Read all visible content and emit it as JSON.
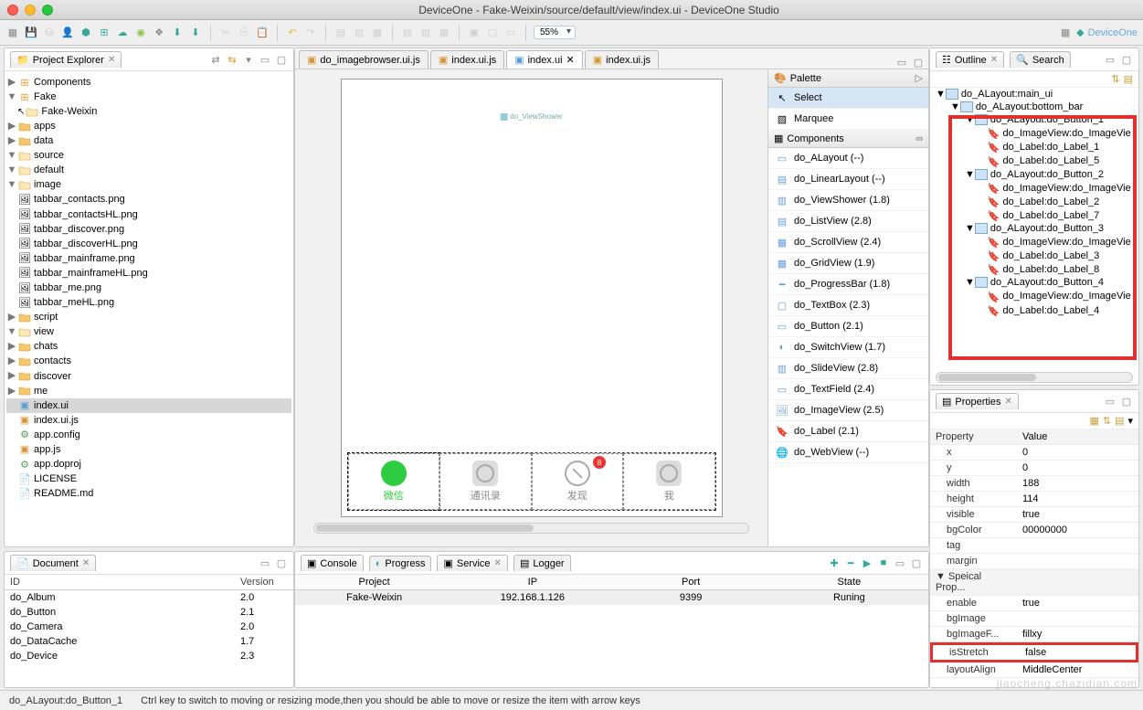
{
  "window": {
    "title": "DeviceOne - Fake-Weixin/source/default/view/index.ui - DeviceOne Studio"
  },
  "toolbar": {
    "zoom": "55%",
    "brand": "DeviceOne"
  },
  "projectExplorer": {
    "title": "Project Explorer",
    "tree": {
      "components": "Components",
      "fake": "Fake",
      "fakeWeixin": "Fake-Weixin",
      "apps": "apps",
      "data": "data",
      "source": "source",
      "default": "default",
      "image": "image",
      "imgs": [
        "tabbar_contacts.png",
        "tabbar_contactsHL.png",
        "tabbar_discover.png",
        "tabbar_discoverHL.png",
        "tabbar_mainframe.png",
        "tabbar_mainframeHL.png",
        "tabbar_me.png",
        "tabbar_meHL.png"
      ],
      "script": "script",
      "view": "view",
      "views": [
        "chats",
        "contacts",
        "discover",
        "me"
      ],
      "indexui": "index.ui",
      "indexuijs": "index.ui.js",
      "appconfig": "app.config",
      "appjs": "app.js",
      "appdoproj": "app.doproj",
      "license": "LICENSE",
      "readme": "README.md"
    }
  },
  "editorTabs": [
    "do_imagebrowser.ui.js",
    "index.ui.js",
    "index.ui",
    "index.ui.js"
  ],
  "canvas": {
    "vslabel": "do_ViewShower",
    "btns": [
      "微信",
      "通讯录",
      "发现",
      "我"
    ],
    "badge": "8"
  },
  "palette": {
    "title": "Palette",
    "select": "Select",
    "marquee": "Marquee",
    "componentsTitle": "Components",
    "items": [
      "do_ALayout (--)",
      "do_LinearLayout (--)",
      "do_ViewShower (1.8)",
      "do_ListView (2.8)",
      "do_ScrollView (2.4)",
      "do_GridView (1.9)",
      "do_ProgressBar (1.8)",
      "do_TextBox (2.3)",
      "do_Button (2.1)",
      "do_SwitchView (1.7)",
      "do_SlideView (2.8)",
      "do_TextField (2.4)",
      "do_ImageView (2.5)",
      "do_Label (2.1)",
      "do_WebView (--)"
    ]
  },
  "outline": {
    "title": "Outline",
    "searchTab": "Search",
    "items": [
      {
        "d": 0,
        "t": "do_ALayout:main_ui",
        "exp": "▼"
      },
      {
        "d": 1,
        "t": "do_ALayout:bottom_bar",
        "exp": "▼"
      },
      {
        "d": 2,
        "t": "do_ALayout:do_Button_1",
        "exp": "▼"
      },
      {
        "d": 3,
        "t": "do_ImageView:do_ImageVie",
        "tag": true
      },
      {
        "d": 3,
        "t": "do_Label:do_Label_1",
        "tag": true
      },
      {
        "d": 3,
        "t": "do_Label:do_Label_5",
        "tag": true
      },
      {
        "d": 2,
        "t": "do_ALayout:do_Button_2",
        "exp": "▼"
      },
      {
        "d": 3,
        "t": "do_ImageView:do_ImageVie",
        "tag": true
      },
      {
        "d": 3,
        "t": "do_Label:do_Label_2",
        "tag": true
      },
      {
        "d": 3,
        "t": "do_Label:do_Label_7",
        "tag": true
      },
      {
        "d": 2,
        "t": "do_ALayout:do_Button_3",
        "exp": "▼"
      },
      {
        "d": 3,
        "t": "do_ImageView:do_ImageVie",
        "tag": true
      },
      {
        "d": 3,
        "t": "do_Label:do_Label_3",
        "tag": true
      },
      {
        "d": 3,
        "t": "do_Label:do_Label_8",
        "tag": true
      },
      {
        "d": 2,
        "t": "do_ALayout:do_Button_4",
        "exp": "▼"
      },
      {
        "d": 3,
        "t": "do_ImageView:do_ImageVie",
        "tag": true
      },
      {
        "d": 3,
        "t": "do_Label:do_Label_4",
        "tag": true
      }
    ]
  },
  "properties": {
    "title": "Properties",
    "headers": {
      "k": "Property",
      "v": "Value"
    },
    "rows": [
      {
        "k": "x",
        "v": "0",
        "sub": true
      },
      {
        "k": "y",
        "v": "0",
        "sub": true
      },
      {
        "k": "width",
        "v": "188",
        "sub": true
      },
      {
        "k": "height",
        "v": "114",
        "sub": true
      },
      {
        "k": "visible",
        "v": "true",
        "sub": true
      },
      {
        "k": "bgColor",
        "v": "00000000",
        "sub": true
      },
      {
        "k": "tag",
        "v": "",
        "sub": true
      },
      {
        "k": "margin",
        "v": "",
        "sub": true
      },
      {
        "k": "Speical Prop...",
        "v": "",
        "group": true
      },
      {
        "k": "enable",
        "v": "true",
        "sub": true
      },
      {
        "k": "bgImage",
        "v": "",
        "sub": true
      },
      {
        "k": "bgImageF...",
        "v": "fillxy",
        "sub": true
      },
      {
        "k": "isStretch",
        "v": "false",
        "sub": true,
        "hl": true
      },
      {
        "k": "layoutAlign",
        "v": "MiddleCenter",
        "sub": true
      }
    ]
  },
  "document": {
    "title": "Document",
    "headers": {
      "id": "ID",
      "ver": "Version"
    },
    "rows": [
      {
        "id": "do_Album",
        "v": "2.0"
      },
      {
        "id": "do_Button",
        "v": "2.1"
      },
      {
        "id": "do_Camera",
        "v": "2.0"
      },
      {
        "id": "do_DataCache",
        "v": "1.7"
      },
      {
        "id": "do_Device",
        "v": "2.3"
      }
    ]
  },
  "console": {
    "tabs": [
      "Console",
      "Progress",
      "Service",
      "Logger"
    ],
    "headers": [
      "Project",
      "IP",
      "Port",
      "State"
    ],
    "row": [
      "Fake-Weixin",
      "192.168.1.126",
      "9399",
      "Runing"
    ]
  },
  "status": {
    "left": "do_ALayout:do_Button_1",
    "hint": "Ctrl key to switch to moving or resizing mode,then you should be able to move or resize the item with arrow keys"
  }
}
